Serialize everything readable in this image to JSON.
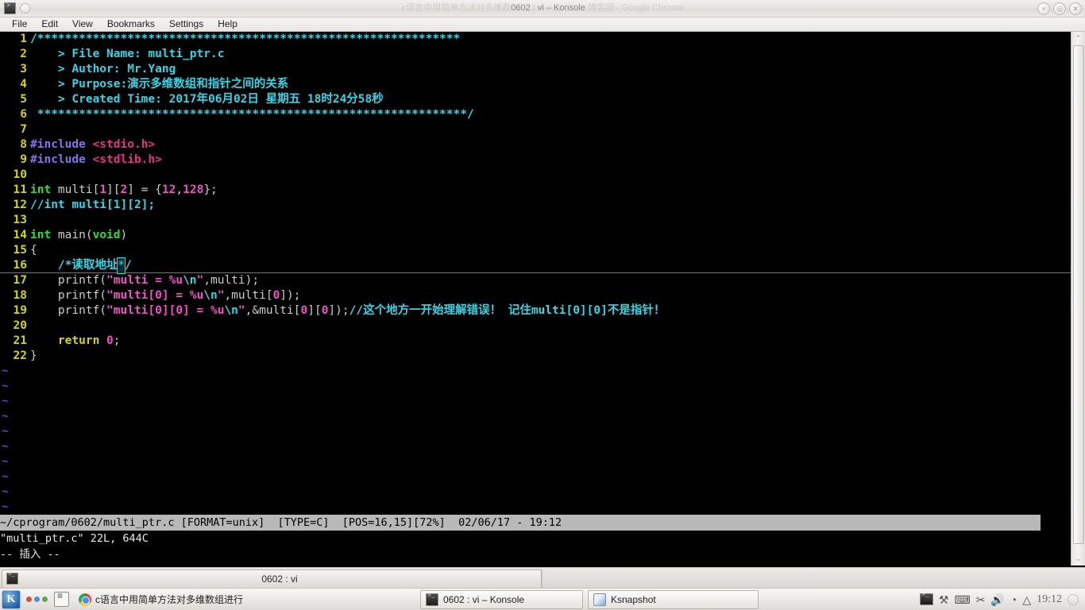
{
  "window": {
    "title_ghost_prefix": "c语言中用简单方法对多维数",
    "title_strong": "0602 : vi – Konsole",
    "title_ghost_suffix": " 博客园 - Google Chrome",
    "minimize_glyph": "˅",
    "maximize_glyph": "◎",
    "close_glyph": "✕",
    "app_icon": "konsole-icon",
    "tab_icon": "terminal-icon"
  },
  "menubar": {
    "items": [
      {
        "label": "File"
      },
      {
        "label": "Edit"
      },
      {
        "label": "View"
      },
      {
        "label": "Bookmarks"
      },
      {
        "label": "Settings"
      },
      {
        "label": "Help"
      }
    ]
  },
  "editor": {
    "lines": [
      {
        "n": "1",
        "tokens": [
          {
            "t": "/",
            "c": "c-comment"
          },
          {
            "t": "*************************************************************",
            "c": "c-comment"
          }
        ]
      },
      {
        "n": "2",
        "tokens": [
          {
            "t": "    > File Name: multi_ptr.c",
            "c": "c-comment"
          }
        ]
      },
      {
        "n": "3",
        "tokens": [
          {
            "t": "    > Author: Mr.Yang",
            "c": "c-comment"
          }
        ]
      },
      {
        "n": "4",
        "tokens": [
          {
            "t": "    > Purpose:演示多维数组和指针之间的关系",
            "c": "c-comment"
          }
        ]
      },
      {
        "n": "5",
        "tokens": [
          {
            "t": "    > Created Time: 2017年06月02日 星期五 18时24分58秒",
            "c": "c-comment"
          }
        ]
      },
      {
        "n": "6",
        "tokens": [
          {
            "t": " **************************************************************",
            "c": "c-comment"
          },
          {
            "t": "/",
            "c": "c-comment"
          }
        ]
      },
      {
        "n": "7",
        "tokens": []
      },
      {
        "n": "8",
        "tokens": [
          {
            "t": "#include ",
            "c": "c-pre"
          },
          {
            "t": "<stdio.h>",
            "c": "c-inc"
          }
        ]
      },
      {
        "n": "9",
        "tokens": [
          {
            "t": "#include ",
            "c": "c-pre"
          },
          {
            "t": "<stdlib.h>",
            "c": "c-inc"
          }
        ]
      },
      {
        "n": "10",
        "tokens": []
      },
      {
        "n": "11",
        "tokens": [
          {
            "t": "int",
            "c": "c-type"
          },
          {
            "t": " multi[",
            "c": "c-plain"
          },
          {
            "t": "1",
            "c": "c-num"
          },
          {
            "t": "][",
            "c": "c-plain"
          },
          {
            "t": "2",
            "c": "c-num"
          },
          {
            "t": "] = {",
            "c": "c-plain"
          },
          {
            "t": "12",
            "c": "c-num"
          },
          {
            "t": ",",
            "c": "c-plain"
          },
          {
            "t": "128",
            "c": "c-num"
          },
          {
            "t": "};",
            "c": "c-plain"
          }
        ]
      },
      {
        "n": "12",
        "tokens": [
          {
            "t": "//int multi[1][2];",
            "c": "c-comment"
          }
        ]
      },
      {
        "n": "13",
        "tokens": []
      },
      {
        "n": "14",
        "tokens": [
          {
            "t": "int",
            "c": "c-type"
          },
          {
            "t": " main(",
            "c": "c-plain"
          },
          {
            "t": "void",
            "c": "c-type"
          },
          {
            "t": ")",
            "c": "c-plain"
          }
        ]
      },
      {
        "n": "15",
        "tokens": [
          {
            "t": "{",
            "c": "c-plain"
          }
        ]
      },
      {
        "n": "16",
        "cursorline": true,
        "tokens": [
          {
            "t": "    /*读取地址",
            "c": "c-comment"
          },
          {
            "t": "*",
            "c": "cursorblk"
          },
          {
            "t": "/",
            "c": "c-comment"
          }
        ]
      },
      {
        "n": "17",
        "tokens": [
          {
            "t": "    printf(",
            "c": "c-plain"
          },
          {
            "t": "\"multi = %u",
            "c": "c-str"
          },
          {
            "t": "\\n",
            "c": "c-esc"
          },
          {
            "t": "\"",
            "c": "c-str"
          },
          {
            "t": ",multi);",
            "c": "c-plain"
          }
        ]
      },
      {
        "n": "18",
        "tokens": [
          {
            "t": "    printf(",
            "c": "c-plain"
          },
          {
            "t": "\"multi[0] = %u",
            "c": "c-str"
          },
          {
            "t": "\\n",
            "c": "c-esc"
          },
          {
            "t": "\"",
            "c": "c-str"
          },
          {
            "t": ",multi[",
            "c": "c-plain"
          },
          {
            "t": "0",
            "c": "c-num"
          },
          {
            "t": "]);",
            "c": "c-plain"
          }
        ]
      },
      {
        "n": "19",
        "tokens": [
          {
            "t": "    printf(",
            "c": "c-plain"
          },
          {
            "t": "\"multi[0][0] = %u",
            "c": "c-str"
          },
          {
            "t": "\\n",
            "c": "c-esc"
          },
          {
            "t": "\"",
            "c": "c-str"
          },
          {
            "t": ",&multi[",
            "c": "c-plain"
          },
          {
            "t": "0",
            "c": "c-num"
          },
          {
            "t": "][",
            "c": "c-plain"
          },
          {
            "t": "0",
            "c": "c-num"
          },
          {
            "t": "]);",
            "c": "c-plain"
          },
          {
            "t": "//这个地方一开始理解错误！ 记住multi[0][0]不是指针！",
            "c": "c-comment"
          }
        ]
      },
      {
        "n": "20",
        "tokens": []
      },
      {
        "n": "21",
        "tokens": [
          {
            "t": "    ",
            "c": "c-plain"
          },
          {
            "t": "return",
            "c": "c-kw"
          },
          {
            "t": " ",
            "c": "c-plain"
          },
          {
            "t": "0",
            "c": "c-num"
          },
          {
            "t": ";",
            "c": "c-plain"
          }
        ]
      },
      {
        "n": "22",
        "tokens": [
          {
            "t": "}",
            "c": "c-plain"
          }
        ]
      }
    ],
    "tilde_count": 11,
    "tilde_glyph": "~"
  },
  "vim": {
    "statusline": "~/cprogram/0602/multi_ptr.c [FORMAT=unix]  [TYPE=C]  [POS=16,15][72%]  02/06/17 - 19:12",
    "message": "\"multi_ptr.c\" 22L, 644C",
    "mode": "-- 插入 --"
  },
  "scrollbar": {
    "up_glyph": "⌃",
    "down_glyph": "⌄"
  },
  "konsole_tabs": {
    "active_label": "0602 : vi"
  },
  "taskbar": {
    "kmenu_label": "K",
    "pager_dots": [
      "#d94f3d",
      "#4f8fd9",
      "#5aa84f"
    ],
    "buttons": [
      {
        "label": "c语言中用简单方法对多维数组进行",
        "icon": "chrome-icon"
      },
      {
        "label": "0602 : vi – Konsole",
        "icon": "konsole-icon"
      },
      {
        "label": "Ksnapshot",
        "icon": "ksnapshot-icon"
      }
    ],
    "tray": {
      "tools_glyph": "⚒",
      "keyboard_glyph": "⌨",
      "scissors_glyph": "✂",
      "volume_glyph": "🔊",
      "wifi_glyph": "◔",
      "cloud_glyph": "△",
      "clock": "19:12"
    }
  }
}
